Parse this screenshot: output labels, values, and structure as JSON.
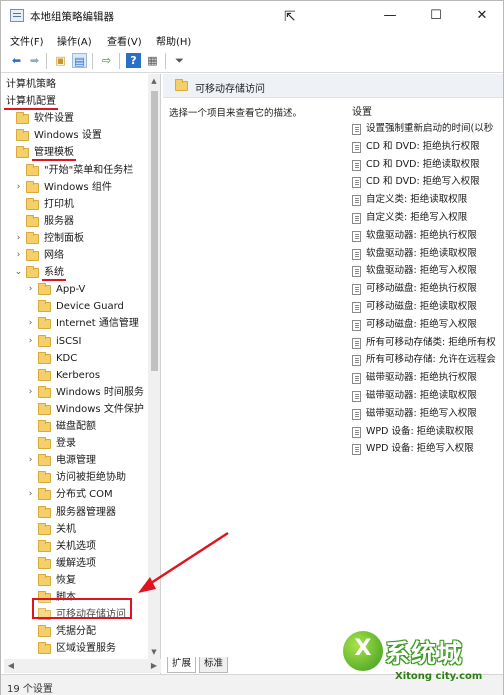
{
  "window": {
    "title": "本地组策略编辑器",
    "controls": {
      "minimize": "—",
      "maximize": "☐",
      "close": "✕"
    }
  },
  "menu": [
    "文件(F)",
    "操作(A)",
    "查看(V)",
    "帮助(H)"
  ],
  "toolbar": [
    "back-arrow-icon",
    "forward-arrow-icon",
    "up-folder-icon",
    "show-tree-icon",
    "export-icon",
    "help-icon",
    "properties-icon",
    "filter-icon"
  ],
  "tree": [
    {
      "label": "计算机策略",
      "level": 0,
      "expander": ""
    },
    {
      "label": "计算机配置",
      "level": 0,
      "expander": "",
      "underlined": true
    },
    {
      "label": "软件设置",
      "level": 0,
      "expander": "",
      "folder": true
    },
    {
      "label": "Windows 设置",
      "level": 0,
      "expander": "",
      "folder": true
    },
    {
      "label": "管理模板",
      "level": 0,
      "expander": "",
      "folder": true,
      "underlined": true
    },
    {
      "label": "\"开始\"菜单和任务栏",
      "level": 1,
      "expander": "",
      "folder": true
    },
    {
      "label": "Windows 组件",
      "level": 1,
      "expander": ">",
      "folder": true
    },
    {
      "label": "打印机",
      "level": 1,
      "expander": "",
      "folder": true
    },
    {
      "label": "服务器",
      "level": 1,
      "expander": "",
      "folder": true
    },
    {
      "label": "控制面板",
      "level": 1,
      "expander": ">",
      "folder": true
    },
    {
      "label": "网络",
      "level": 1,
      "expander": ">",
      "folder": true
    },
    {
      "label": "系统",
      "level": 1,
      "expander": "v",
      "folder": true,
      "underlined": true
    },
    {
      "label": "App-V",
      "level": 2,
      "expander": ">",
      "folder": true
    },
    {
      "label": "Device Guard",
      "level": 2,
      "expander": "",
      "folder": true
    },
    {
      "label": "Internet 通信管理",
      "level": 2,
      "expander": ">",
      "folder": true
    },
    {
      "label": "iSCSI",
      "level": 2,
      "expander": ">",
      "folder": true
    },
    {
      "label": "KDC",
      "level": 2,
      "expander": "",
      "folder": true
    },
    {
      "label": "Kerberos",
      "level": 2,
      "expander": "",
      "folder": true
    },
    {
      "label": "Windows 时间服务",
      "level": 2,
      "expander": ">",
      "folder": true
    },
    {
      "label": "Windows 文件保护",
      "level": 2,
      "expander": "",
      "folder": true
    },
    {
      "label": "磁盘配额",
      "level": 2,
      "expander": "",
      "folder": true
    },
    {
      "label": "登录",
      "level": 2,
      "expander": "",
      "folder": true
    },
    {
      "label": "电源管理",
      "level": 2,
      "expander": ">",
      "folder": true
    },
    {
      "label": "访问被拒绝协助",
      "level": 2,
      "expander": "",
      "folder": true
    },
    {
      "label": "分布式 COM",
      "level": 2,
      "expander": ">",
      "folder": true
    },
    {
      "label": "服务器管理器",
      "level": 2,
      "expander": "",
      "folder": true
    },
    {
      "label": "关机",
      "level": 2,
      "expander": "",
      "folder": true
    },
    {
      "label": "关机选项",
      "level": 2,
      "expander": "",
      "folder": true
    },
    {
      "label": "缓解选项",
      "level": 2,
      "expander": "",
      "folder": true
    },
    {
      "label": "恢复",
      "level": 2,
      "expander": "",
      "folder": true
    },
    {
      "label": "脚本",
      "level": 2,
      "expander": "",
      "folder": true
    },
    {
      "label": "可移动存储访问",
      "level": 2,
      "expander": "",
      "folder": true,
      "selected": true
    },
    {
      "label": "凭据分配",
      "level": 2,
      "expander": "",
      "folder": true
    },
    {
      "label": "区域设置服务",
      "level": 2,
      "expander": "",
      "folder": true
    }
  ],
  "right_pane": {
    "header_title": "可移动存储访问",
    "description": "选择一个项目来查看它的描述。",
    "settings_column": "设置",
    "settings": [
      "设置强制重新启动的时间(以秒",
      "CD 和 DVD: 拒绝执行权限",
      "CD 和 DVD: 拒绝读取权限",
      "CD 和 DVD: 拒绝写入权限",
      "自定义类: 拒绝读取权限",
      "自定义类: 拒绝写入权限",
      "软盘驱动器: 拒绝执行权限",
      "软盘驱动器: 拒绝读取权限",
      "软盘驱动器: 拒绝写入权限",
      "可移动磁盘: 拒绝执行权限",
      "可移动磁盘: 拒绝读取权限",
      "可移动磁盘: 拒绝写入权限",
      "所有可移动存储类: 拒绝所有权",
      "所有可移动存储: 允许在远程会",
      "磁带驱动器: 拒绝执行权限",
      "磁带驱动器: 拒绝读取权限",
      "磁带驱动器: 拒绝写入权限",
      "WPD 设备: 拒绝读取权限",
      "WPD 设备: 拒绝写入权限"
    ]
  },
  "tabs": [
    "扩展",
    "标准"
  ],
  "status": "19 个设置",
  "watermark": {
    "text": "系统城",
    "url": "Xitong city.com"
  },
  "colors": {
    "annotation_red": "#e0141e",
    "folder_yellow": "#f4cf6a",
    "header_bg": "#eef1f6"
  }
}
